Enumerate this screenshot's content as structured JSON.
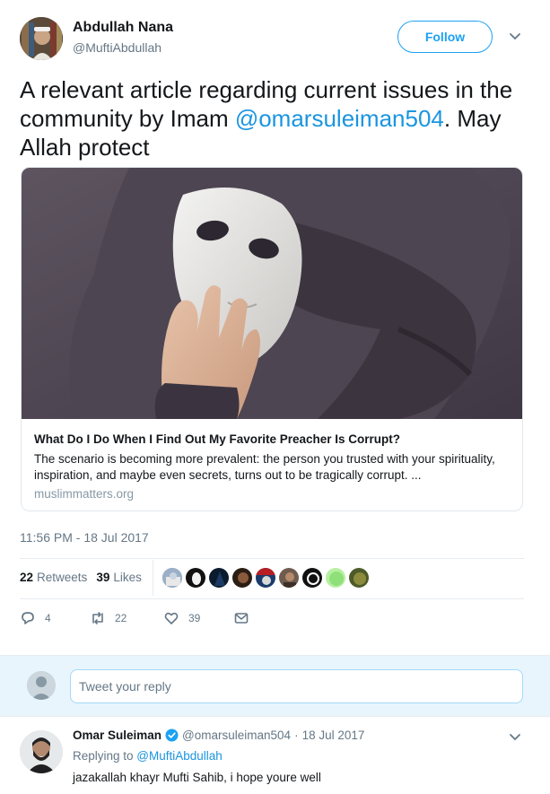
{
  "author": {
    "name": "Abdullah Nana",
    "handle": "@MuftiAbdullah",
    "follow_label": "Follow"
  },
  "tweet": {
    "text_before": "A relevant article regarding current issues in the community by Imam ",
    "mention": "@omarsuleiman504",
    "text_after": ". May Allah protect"
  },
  "card": {
    "title": "What Do I Do When I Find Out My Favorite Preacher Is Corrupt?",
    "description": "The scenario is becoming more prevalent: the person you trusted with your spirituality, inspiration, and maybe even secrets, turns out to be tragically corrupt. ...",
    "domain": "muslimmatters.org"
  },
  "timestamp": "11:56 PM - 18 Jul 2017",
  "stats": {
    "retweets_count": "22",
    "retweets_label": "Retweets",
    "likes_count": "39",
    "likes_label": "Likes"
  },
  "actions": {
    "reply_count": "4",
    "retweet_count": "22",
    "like_count": "39"
  },
  "reply_box": {
    "placeholder": "Tweet your reply"
  },
  "reply_tweet": {
    "name": "Omar Suleiman",
    "handle": "@omarsuleiman504",
    "date": "18 Jul 2017",
    "replying_prefix": "Replying to ",
    "replying_to": "@MuftiAbdullah",
    "text": "jazakallah khayr Mufti Sahib, i hope youre well"
  },
  "colors": {
    "accent": "#1da1f2",
    "link": "#1b95e0",
    "secondary_text": "#657786",
    "reply_bg": "#e8f5fd"
  },
  "icons": [
    "chevron-down-icon",
    "reply-icon",
    "retweet-icon",
    "heart-icon",
    "direct-message-icon",
    "verified-icon"
  ]
}
